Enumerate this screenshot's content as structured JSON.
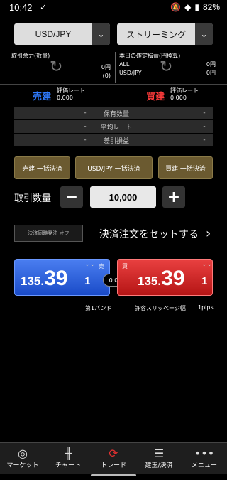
{
  "status": {
    "time": "10:42",
    "battery": "82%"
  },
  "selectors": {
    "pair": "USD/JPY",
    "mode": "ストリーミング"
  },
  "margin": {
    "label": "取引余力(数量)",
    "value": "0円",
    "sub": "(0)"
  },
  "pnl": {
    "label": "本日の確定損益(円換算)",
    "all_label": "ALL",
    "all_value": "0円",
    "pair_label": "USD/JPY",
    "pair_value": "0円"
  },
  "sell_side": {
    "label": "売建",
    "caption": "評価レート",
    "value": "0.000",
    "color": "#2f7bff"
  },
  "buy_side": {
    "label": "買建",
    "caption": "評価レート",
    "value": "0.000",
    "color": "#ff3b3b"
  },
  "stats": [
    {
      "name": "保有数量",
      "left": "-",
      "right": "-"
    },
    {
      "name": "平均レート",
      "left": "-",
      "right": "-"
    },
    {
      "name": "差引損益",
      "left": "-",
      "right": "-"
    }
  ],
  "bulk_buttons": {
    "sell": "売建 一括決済",
    "pair": "USD/JPY 一括決済",
    "buy": "買建 一括決済"
  },
  "quantity": {
    "label": "取引数量",
    "value": "10,000",
    "minus": "−",
    "plus": "+"
  },
  "settle": {
    "toggle": "決済同時発注 オフ",
    "link": "決済注文をセットする",
    "arrow": "›"
  },
  "sell_rate": {
    "int": "135.",
    "pips": "39",
    "frac": "1",
    "tag": "売"
  },
  "buy_rate": {
    "int": "135.",
    "pips": "39",
    "frac": "1",
    "tag": "買"
  },
  "spread": "0.0",
  "band": "第1バンド",
  "slippage": {
    "label": "許容スリッページ幅",
    "value": "1pips"
  },
  "tabs": [
    {
      "label": "マーケット",
      "icon": "globe-icon"
    },
    {
      "label": "チャート",
      "icon": "candlestick-icon"
    },
    {
      "label": "トレード",
      "icon": "trade-icon"
    },
    {
      "label": "建玉/決済",
      "icon": "coins-icon"
    },
    {
      "label": "メニュー",
      "icon": "more-icon"
    }
  ]
}
